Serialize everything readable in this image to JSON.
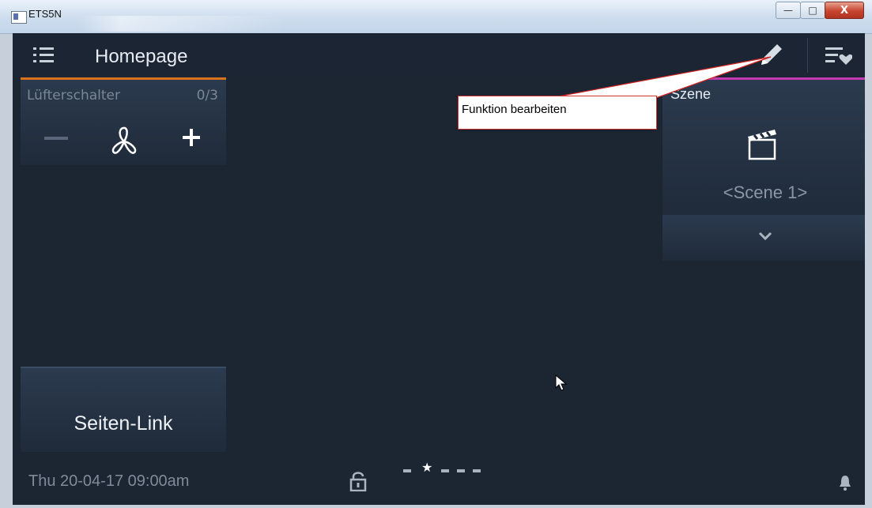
{
  "window": {
    "title": "ETS5N",
    "minimize": "—",
    "maximize": "□",
    "close": "X"
  },
  "header": {
    "title": "Homepage"
  },
  "tiles": {
    "fan": {
      "label": "Lüfterschalter",
      "count": "0/3"
    },
    "link": {
      "label": "Seiten-Link"
    },
    "scene": {
      "title": "Szene",
      "value": "<Scene 1>"
    }
  },
  "tooltip": {
    "text": "Funktion bearbeiten"
  },
  "footer": {
    "datetime": "Thu 20-04-17  09:00am",
    "page_count": 5,
    "active_page": 2
  },
  "colors": {
    "app_bg": "#1c2532",
    "fan_accent": "#d9721a",
    "scene_accent": "#c13ab0",
    "callout_red": "#cc2222"
  },
  "icons": [
    "menu-icon",
    "pencil-icon",
    "list-heart-icon",
    "fan-icon",
    "plus-icon",
    "minus-icon",
    "clapper-icon",
    "chevron-down-icon",
    "lock-icon",
    "star-icon",
    "bell-icon"
  ]
}
